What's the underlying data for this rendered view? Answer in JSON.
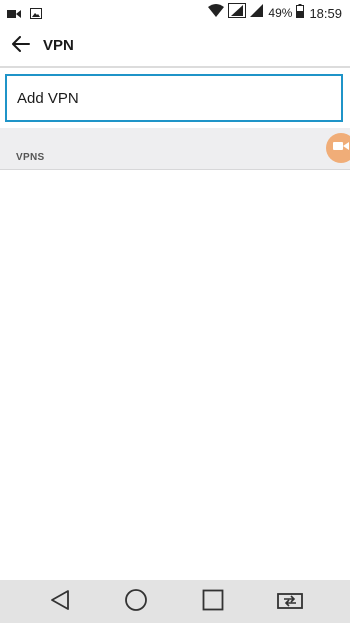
{
  "status_bar": {
    "battery_percent": "49%",
    "time": "18:59",
    "icons": [
      "video-camera-icon",
      "image-icon",
      "wifi-icon",
      "signal-icon",
      "signal-icon",
      "battery-icon"
    ]
  },
  "header": {
    "title": "VPN",
    "back_icon": "arrow-left-icon"
  },
  "add_vpn": {
    "label": "Add VPN"
  },
  "section": {
    "label": "VPNS"
  },
  "floating_button": {
    "icon": "video-camera-icon",
    "color": "#f0ad78"
  },
  "nav_bar": {
    "buttons": [
      "back-icon",
      "home-icon",
      "recents-icon",
      "switch-apps-icon"
    ]
  },
  "colors": {
    "accent": "#1f94c8",
    "section_bg": "#eeeef0",
    "nav_bg": "#e3e3e3"
  }
}
